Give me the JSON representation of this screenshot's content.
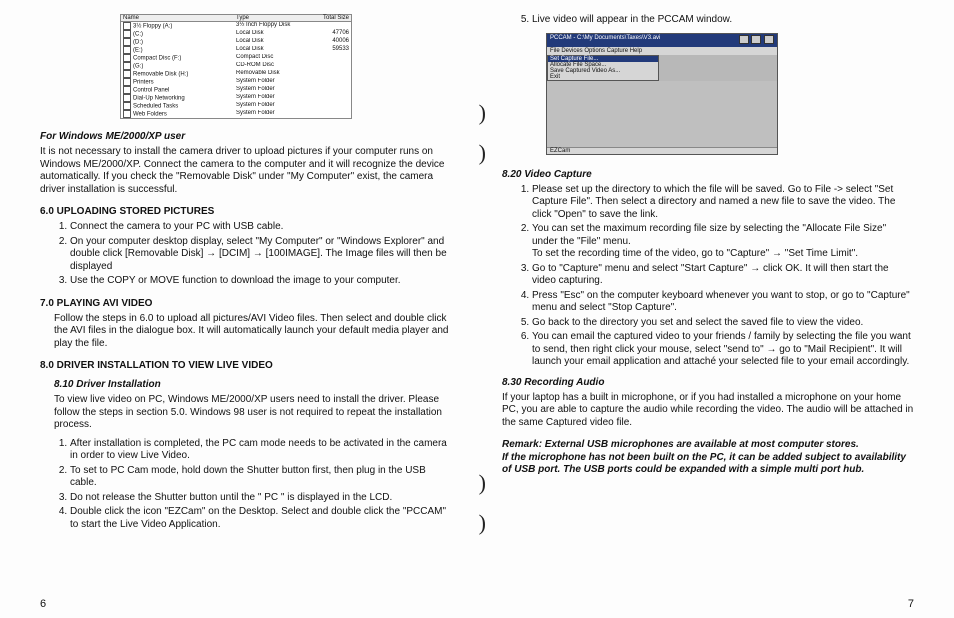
{
  "explorer": {
    "headers": [
      "Name",
      "Type",
      "Total Size"
    ],
    "rows": [
      {
        "name": "3½ Floppy (A:)",
        "type": "3½ Inch Floppy Disk",
        "size": ""
      },
      {
        "name": "(C:)",
        "type": "Local Disk",
        "size": "47706"
      },
      {
        "name": "(D:)",
        "type": "Local Disk",
        "size": "40006"
      },
      {
        "name": "(E:)",
        "type": "Local Disk",
        "size": "59533"
      },
      {
        "name": "Compact Disc (F:)",
        "type": "Compact Disc",
        "size": ""
      },
      {
        "name": "(G:)",
        "type": "CD-ROM Disc",
        "size": ""
      },
      {
        "name": "Removable Disk (H:)",
        "type": "Removable Disk",
        "size": ""
      },
      {
        "name": "Printers",
        "type": "System Folder",
        "size": ""
      },
      {
        "name": "Control Panel",
        "type": "System Folder",
        "size": ""
      },
      {
        "name": "Dial-Up Networking",
        "type": "System Folder",
        "size": ""
      },
      {
        "name": "Scheduled Tasks",
        "type": "System Folder",
        "size": ""
      },
      {
        "name": "Web Folders",
        "type": "System Folder",
        "size": ""
      }
    ]
  },
  "left": {
    "for_user_heading": "For Windows ME/2000/XP user",
    "for_user_body": "It is not necessary to install the camera driver to upload pictures if your computer runs on Windows ME/2000/XP. Connect the camera to the computer and it will recognize the device automatically. If you check the \"Removable Disk\" under \"My Computer\" exist, the camera driver installation is successful.",
    "s6": "6.0 UPLOADING STORED PICTURES",
    "s6_steps": [
      "Connect the camera to your PC with USB cable.",
      "On your computer desktop display, select \"My Computer\" or \"Windows Explorer\" and double click [Removable Disk] → [DCIM] → [100IMAGE]. The Image files will then be displayed",
      "Use the COPY or MOVE function to download the image to your computer."
    ],
    "s7": "7.0 PLAYING AVI VIDEO",
    "s7_body": "Follow the steps in 6.0 to upload all pictures/AVI Video files. Then select and double click the AVI files in the dialogue box. It will automatically launch your default media player and play the file.",
    "s8": "8.0 DRIVER INSTALLATION TO VIEW LIVE VIDEO",
    "s810": "8.10 Driver Installation",
    "s810_body": "To view live video on PC, Windows ME/2000/XP users need to install the driver. Please follow the steps in section 5.0. Windows 98 user is not required to repeat the installation process.",
    "s810_steps": [
      "After installation is completed, the PC cam mode needs to be activated in the camera in order to view Live Video.",
      "To set to PC Cam mode, hold down the Shutter button first, then plug in the USB cable.",
      "Do not release the Shutter button until the \" PC \" is displayed in the LCD.",
      "Double click the icon \"EZCam\" on the Desktop. Select and double click the \"PCCAM\" to start the Live Video Application."
    ],
    "pagenum": "6"
  },
  "right": {
    "step5": "Live video will appear in the PCCAM window.",
    "pccam": {
      "title": "PCCAM - C:\\My Documents\\Taxes\\V3.avi",
      "menubar": "File   Devices   Options   Capture   Help",
      "menu": [
        "Set Capture File...",
        "Allocate File Space...",
        "Save Captured Video As...",
        "Exit"
      ],
      "status": "EZCam"
    },
    "s820": "8.20 Video Capture",
    "s820_steps": [
      "Please set up the directory to which the file will be saved. Go to File -> select \"Set Capture File\". Then select a directory and named a new file to save the video. The click \"Open\" to save the link.",
      "You can set the maximum recording file size by selecting the \"Allocate File Size\" under the \"File\" menu.\nTo set the recording time of the video, go to \"Capture\" → \"Set Time Limit\".",
      "Go to \"Capture\" menu and select \"Start Capture\" → click OK. It will then start the video capturing.",
      "Press \"Esc\" on the computer keyboard whenever you want to stop, or go to \"Capture\" menu and select \"Stop Capture\".",
      "Go back to the directory you set and select the saved file to view the video.",
      "You can email the captured video to your friends / family by selecting the file you want to send, then right click your mouse, select \"send to\" → go to \"Mail Recipient\". It will launch your email application and attaché your selected file to your email accordingly."
    ],
    "s830": "8.30 Recording Audio",
    "s830_body": "If your laptop has a built in microphone, or if you had installed a microphone on your home PC, you are able to capture the audio while recording the video. The audio will be attached in the same Captured video file.",
    "remark": "Remark: External USB microphones are available at most computer stores.\nIf the microphone has not been built on the PC, it can be added subject to availability of USB port. The USB ports could be expanded with a simple multi port hub.",
    "pagenum": "7"
  }
}
